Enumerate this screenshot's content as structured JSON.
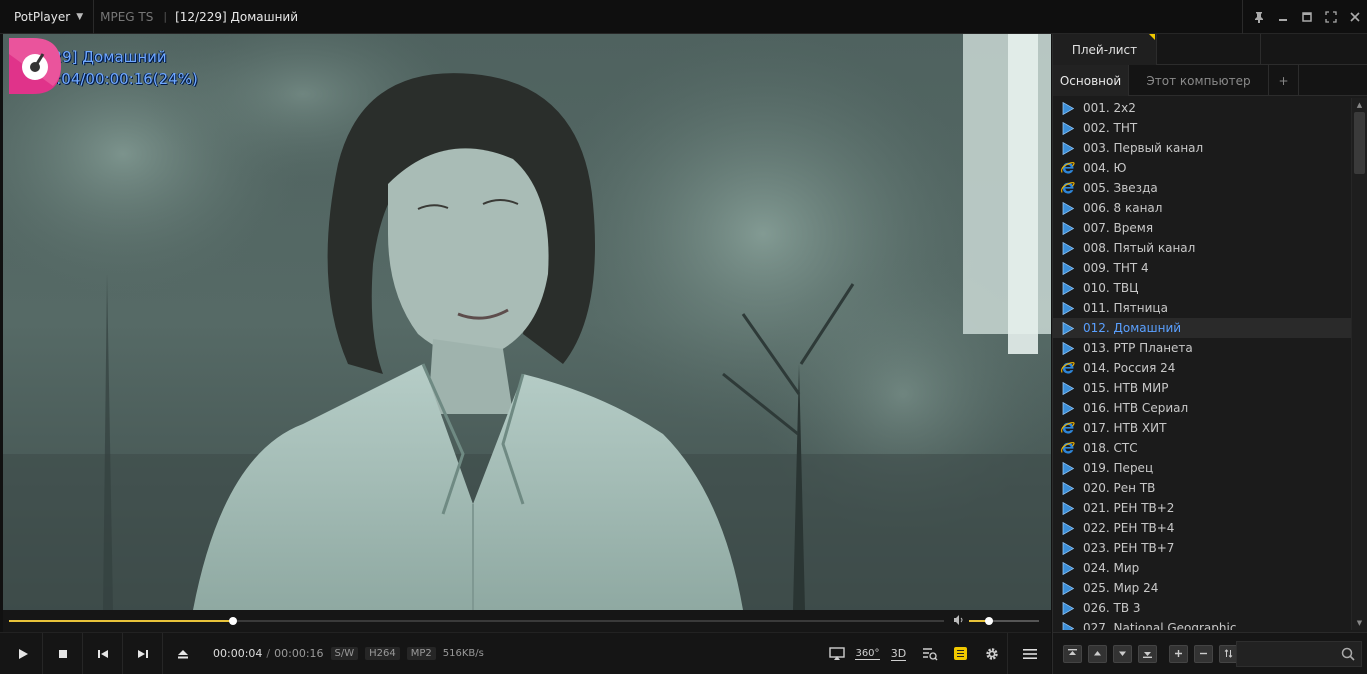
{
  "titlebar": {
    "app_name": "PotPlayer",
    "format": "MPEG TS",
    "separator": "|",
    "title": "[12/229] Домашний"
  },
  "osd": {
    "line1": "[12/229] Домашний",
    "line2": "00:00:04/00:00:16(24%)"
  },
  "playback": {
    "progress_fraction": 0.24,
    "volume_fraction": 0.28
  },
  "controls": {
    "time_current": "00:00:04",
    "time_separator": "/",
    "time_total": "00:00:16",
    "badge_sw": "S/W",
    "badge_codec": "H264",
    "badge_audio": "MP2",
    "bitrate": "516KB/s",
    "label_360": "360°",
    "label_3d": "3D"
  },
  "panel": {
    "main_tab": "Плей-лист",
    "sub_tabs": {
      "main": "Основной",
      "computer": "Этот компьютер",
      "add": "+"
    },
    "search_placeholder": ""
  },
  "playlist": [
    {
      "label": "001. 2x2",
      "icon": "play-icon"
    },
    {
      "label": "002. ТНТ",
      "icon": "play-icon"
    },
    {
      "label": "003. Первый канал",
      "icon": "play-icon"
    },
    {
      "label": "004. Ю",
      "icon": "ie-icon"
    },
    {
      "label": "005. Звезда",
      "icon": "ie-icon"
    },
    {
      "label": "006. 8 канал",
      "icon": "play-icon"
    },
    {
      "label": "007. Время",
      "icon": "play-icon"
    },
    {
      "label": "008. Пятый канал",
      "icon": "play-icon"
    },
    {
      "label": "009. ТНТ 4",
      "icon": "play-icon"
    },
    {
      "label": "010. ТВЦ",
      "icon": "play-icon"
    },
    {
      "label": "011. Пятница",
      "icon": "play-icon"
    },
    {
      "label": "012. Домашний",
      "icon": "play-icon",
      "current": true
    },
    {
      "label": "013. РТР Планета",
      "icon": "play-icon"
    },
    {
      "label": "014. Россия 24",
      "icon": "ie-icon"
    },
    {
      "label": "015. НТВ МИР",
      "icon": "play-icon"
    },
    {
      "label": "016. НТВ Сериал",
      "icon": "play-icon"
    },
    {
      "label": "017. НТВ ХИТ",
      "icon": "ie-icon"
    },
    {
      "label": "018. СТС",
      "icon": "ie-icon"
    },
    {
      "label": "019. Перец",
      "icon": "play-icon"
    },
    {
      "label": "020. Рен ТВ",
      "icon": "play-icon"
    },
    {
      "label": "021. РЕН ТВ+2",
      "icon": "play-icon"
    },
    {
      "label": "022. РЕН ТВ+4",
      "icon": "play-icon"
    },
    {
      "label": "023. РЕН ТВ+7",
      "icon": "play-icon"
    },
    {
      "label": "024. Мир",
      "icon": "play-icon"
    },
    {
      "label": "025. Мир 24",
      "icon": "play-icon"
    },
    {
      "label": "026. ТВ 3",
      "icon": "play-icon"
    },
    {
      "label": "027. National Geographic",
      "icon": "play-icon"
    }
  ],
  "colors": {
    "accent": "#f0c800",
    "current_item": "#5aa0ff",
    "osd_text": "#6fa8ff",
    "channel_logo": "#e0338a"
  }
}
